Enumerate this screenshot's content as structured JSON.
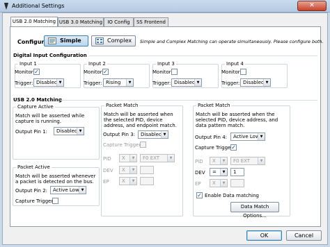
{
  "window": {
    "title": "Additional Settings",
    "close_glyph": "✕"
  },
  "tabs": [
    {
      "label": "USB 2.0 Matching"
    },
    {
      "label": "USB 3.0 Matching"
    },
    {
      "label": "IO Config"
    },
    {
      "label": "SS Frontend"
    }
  ],
  "configure": {
    "label": "Configure:",
    "simple_label": "Simple",
    "complex_label": "Complex",
    "note": "Simple and Complex Matching can operate simultaneously. Please configure both."
  },
  "digital_input": {
    "heading": "Digital Input Configuration",
    "monitor_label": "Monitor:",
    "trigger_label": "Trigger:",
    "inputs": [
      {
        "title": "Input 1",
        "monitor": "✓",
        "trigger": "Disabled"
      },
      {
        "title": "Input 2",
        "monitor": "✓",
        "trigger": "Rising"
      },
      {
        "title": "Input 3",
        "monitor": "",
        "trigger": "Disabled"
      },
      {
        "title": "Input 4",
        "monitor": "",
        "trigger": "Disabled"
      }
    ]
  },
  "usb20": {
    "heading": "USB 2.0 Matching",
    "capture_active": {
      "title": "Capture Active",
      "desc": "Match will be asserted while capture is running.",
      "output_label": "Output Pin 1:",
      "output_value": "Disabled"
    },
    "packet_active": {
      "title": "Packet Active",
      "desc": "Match will be asserted whenever a packet is detected on the bus.",
      "output_label": "Output Pin 2:",
      "output_value": "Active Low",
      "capture_trigger_label": "Capture Trigger:",
      "capture_trigger": ""
    },
    "packet_match_1": {
      "title": "Packet Match",
      "desc": "Match will be asserted when the selected PID, device address, and endpoint match.",
      "output_label": "Output Pin 3:",
      "output_value": "Disabled",
      "capture_trigger_label": "Capture Trigger:",
      "capture_trigger": "",
      "pid_label": "PID",
      "pid_op": "X",
      "pid_value": "F0 EXT",
      "dev_label": "DEV",
      "dev_op": "X",
      "ep_label": "EP",
      "ep_op": "X"
    },
    "packet_match_2": {
      "title": "Packet Match",
      "desc": "Match will be asserted when the selected PID, device address, and data pattern match.",
      "output_label": "Output Pin 4:",
      "output_value": "Active Low",
      "capture_trigger_label": "Capture Trigger:",
      "capture_trigger": "✓",
      "pid_label": "PID",
      "pid_op": "X",
      "pid_value": "F0 EXT",
      "dev_label": "DEV",
      "dev_op": "=",
      "dev_value": "1",
      "ep_label": "EP",
      "ep_op": "X",
      "enable_data_label": "Enable Data matching",
      "enable_data": "✓",
      "data_match_button": "Data Match Options..."
    }
  },
  "footer": {
    "ok_label": "OK",
    "cancel_label": "Cancel"
  }
}
